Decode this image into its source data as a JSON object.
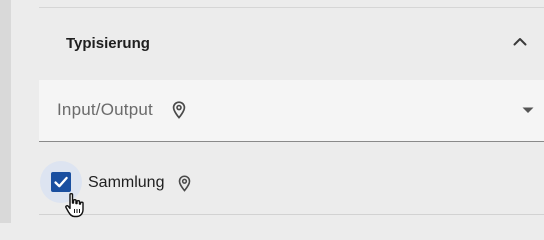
{
  "section": {
    "title": "Typisierung"
  },
  "select": {
    "placeholder": "Input/Output"
  },
  "checkbox": {
    "label": "Sammlung",
    "checked": true
  },
  "icons": {
    "collapse": "chevron-up-icon",
    "select_info": "location-pin-icon",
    "dropdown": "caret-down-icon",
    "checkbox_info": "location-pin-icon",
    "check": "checkmark-icon",
    "cursor": "hand-pointer-cursor-icon"
  },
  "colors": {
    "checkbox_fill": "#1a4fa0",
    "checkbox_halo": "#dde4f1",
    "select_background": "#f5f5f5",
    "panel_background": "#ececec"
  }
}
